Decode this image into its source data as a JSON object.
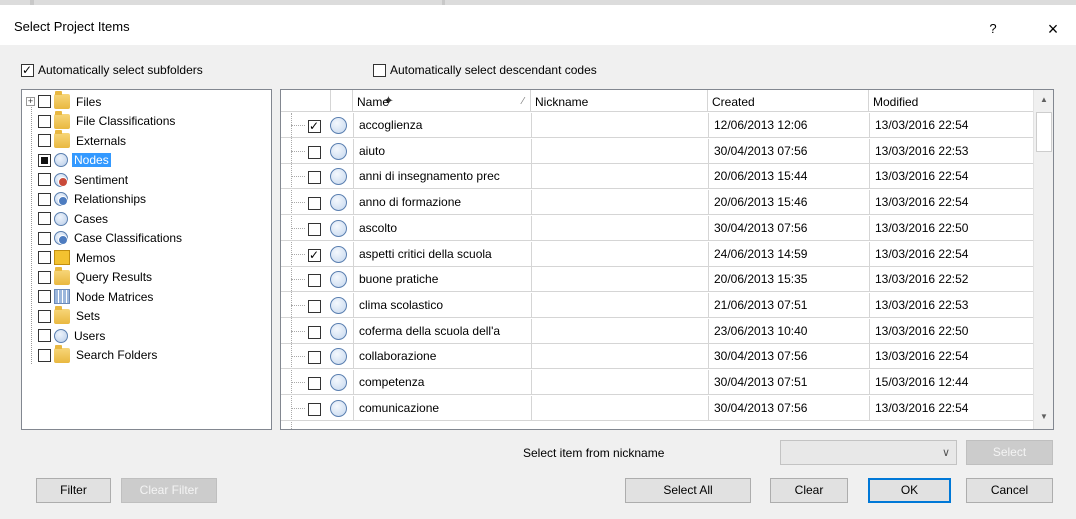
{
  "window": {
    "title": "Select Project Items",
    "help_label": "?",
    "close_label": "×"
  },
  "options": {
    "auto_subfolders": {
      "label": "Automatically select subfolders",
      "checked": true
    },
    "auto_descendants": {
      "label": "Automatically select descendant codes",
      "checked": false
    }
  },
  "tree": {
    "items": [
      {
        "label": "Files",
        "icon": "files-folder-icon",
        "expandable": true,
        "state": "unchecked"
      },
      {
        "label": "File Classifications",
        "icon": "file-classifications-icon",
        "state": "unchecked"
      },
      {
        "label": "Externals",
        "icon": "externals-icon",
        "state": "unchecked"
      },
      {
        "label": "Nodes",
        "icon": "nodes-icon",
        "state": "partial",
        "selected": true
      },
      {
        "label": "Sentiment",
        "icon": "sentiment-icon",
        "state": "unchecked"
      },
      {
        "label": "Relationships",
        "icon": "relationships-icon",
        "state": "unchecked"
      },
      {
        "label": "Cases",
        "icon": "cases-icon",
        "state": "unchecked"
      },
      {
        "label": "Case Classifications",
        "icon": "case-classifications-icon",
        "state": "unchecked"
      },
      {
        "label": "Memos",
        "icon": "memos-icon",
        "state": "unchecked"
      },
      {
        "label": "Query Results",
        "icon": "query-results-icon",
        "state": "unchecked"
      },
      {
        "label": "Node Matrices",
        "icon": "node-matrices-icon",
        "state": "unchecked"
      },
      {
        "label": "Sets",
        "icon": "sets-icon",
        "state": "unchecked"
      },
      {
        "label": "Users",
        "icon": "users-icon",
        "state": "unchecked"
      },
      {
        "label": "Search Folders",
        "icon": "search-folders-icon",
        "state": "unchecked"
      }
    ]
  },
  "grid": {
    "columns": {
      "name": "Name",
      "nickname": "Nickname",
      "created": "Created",
      "modified": "Modified"
    },
    "rows": [
      {
        "checked": true,
        "name": "accoglienza",
        "nickname": "",
        "created": "12/06/2013 12:06",
        "modified": "13/03/2016 22:54"
      },
      {
        "checked": false,
        "name": "aiuto",
        "nickname": "",
        "created": "30/04/2013 07:56",
        "modified": "13/03/2016 22:53"
      },
      {
        "checked": false,
        "name": "anni di insegnamento prec",
        "nickname": "",
        "created": "20/06/2013 15:44",
        "modified": "13/03/2016 22:54"
      },
      {
        "checked": false,
        "name": "anno di formazione",
        "nickname": "",
        "created": "20/06/2013 15:46",
        "modified": "13/03/2016 22:54"
      },
      {
        "checked": false,
        "name": "ascolto",
        "nickname": "",
        "created": "30/04/2013 07:56",
        "modified": "13/03/2016 22:50"
      },
      {
        "checked": true,
        "name": "aspetti critici della scuola",
        "nickname": "",
        "created": "24/06/2013 14:59",
        "modified": "13/03/2016 22:54"
      },
      {
        "checked": false,
        "name": "buone pratiche",
        "nickname": "",
        "created": "20/06/2013 15:35",
        "modified": "13/03/2016 22:52"
      },
      {
        "checked": false,
        "name": "clima scolastico",
        "nickname": "",
        "created": "21/06/2013 07:51",
        "modified": "13/03/2016 22:53"
      },
      {
        "checked": false,
        "name": "coferma della scuola dell'a",
        "nickname": "",
        "created": "23/06/2013 10:40",
        "modified": "13/03/2016 22:50"
      },
      {
        "checked": false,
        "name": "collaborazione",
        "nickname": "",
        "created": "30/04/2013 07:56",
        "modified": "13/03/2016 22:54"
      },
      {
        "checked": false,
        "name": "competenza",
        "nickname": "",
        "created": "30/04/2013 07:51",
        "modified": "15/03/2016 12:44"
      },
      {
        "checked": false,
        "name": "comunicazione",
        "nickname": "",
        "created": "30/04/2013 07:56",
        "modified": "13/03/2016 22:54"
      }
    ]
  },
  "nickname_select": {
    "label": "Select item from nickname",
    "value": ""
  },
  "buttons": {
    "select": "Select",
    "filter": "Filter",
    "clear_filter": "Clear Filter",
    "select_all": "Select All",
    "clear": "Clear",
    "ok": "OK",
    "cancel": "Cancel"
  }
}
